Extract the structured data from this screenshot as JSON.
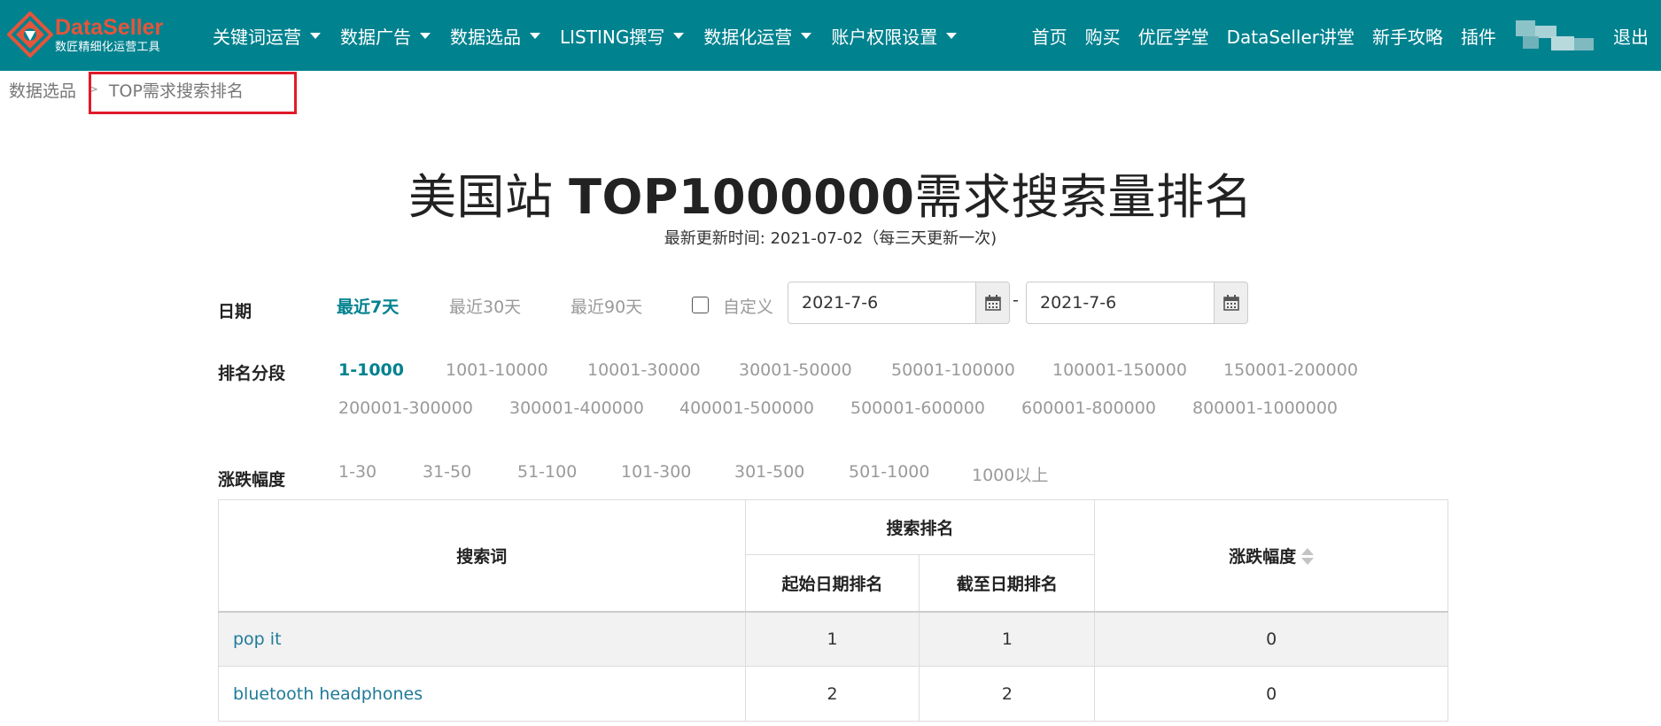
{
  "nav": {
    "logo_title": "DataSeller",
    "logo_subtitle": "数匠精细化运营工具",
    "menu": [
      "关键词运营",
      "数据广告",
      "数据选品",
      "LISTING撰写",
      "数据化运营",
      "账户权限设置"
    ],
    "right_links": [
      "首页",
      "购买",
      "优匠学堂",
      "DataSeller讲堂",
      "新手攻略",
      "插件"
    ],
    "logout": "退出"
  },
  "breadcrumb": {
    "parent": "数据选品",
    "separator": ">",
    "current": "TOP需求搜索排名"
  },
  "header": {
    "title_prefix": "美国站",
    "title_main": "TOP1000000",
    "title_suffix": "需求搜索量排名",
    "update_text": "最新更新时间: 2021-07-02（每三天更新一次)"
  },
  "filters": {
    "date": {
      "label": "日期",
      "options": [
        "最近7天",
        "最近30天",
        "最近90天"
      ],
      "active": "最近7天",
      "custom_label": "自定义",
      "custom_checked": false,
      "start": "2021-7-6",
      "end": "2021-7-6",
      "range_sep": "-"
    },
    "rank_segment": {
      "label": "排名分段",
      "options": [
        "1-1000",
        "1001-10000",
        "10001-30000",
        "30001-50000",
        "50001-100000",
        "100001-150000",
        "150001-200000",
        "200001-300000",
        "300001-400000",
        "400001-500000",
        "500001-600000",
        "600001-800000",
        "800001-1000000"
      ],
      "active": "1-1000"
    },
    "change_range": {
      "label": "涨跌幅度",
      "options": [
        "1-30",
        "31-50",
        "51-100",
        "101-300",
        "301-500",
        "501-1000",
        "1000以上"
      ]
    }
  },
  "table": {
    "col_keyword": "搜索词",
    "col_rank_group": "搜索排名",
    "col_start_rank": "起始日期排名",
    "col_end_rank": "截至日期排名",
    "col_change": "涨跌幅度",
    "rows": [
      {
        "keyword": "pop it",
        "start_rank": "1",
        "end_rank": "1",
        "change": "0"
      },
      {
        "keyword": "bluetooth headphones",
        "start_rank": "2",
        "end_rank": "2",
        "change": "0"
      }
    ]
  },
  "colors": {
    "nav_bg": "#00828f",
    "accent": "#00828f",
    "highlight": "#e11a2a",
    "logo_red": "#e4553b",
    "link": "#1f7a99"
  }
}
